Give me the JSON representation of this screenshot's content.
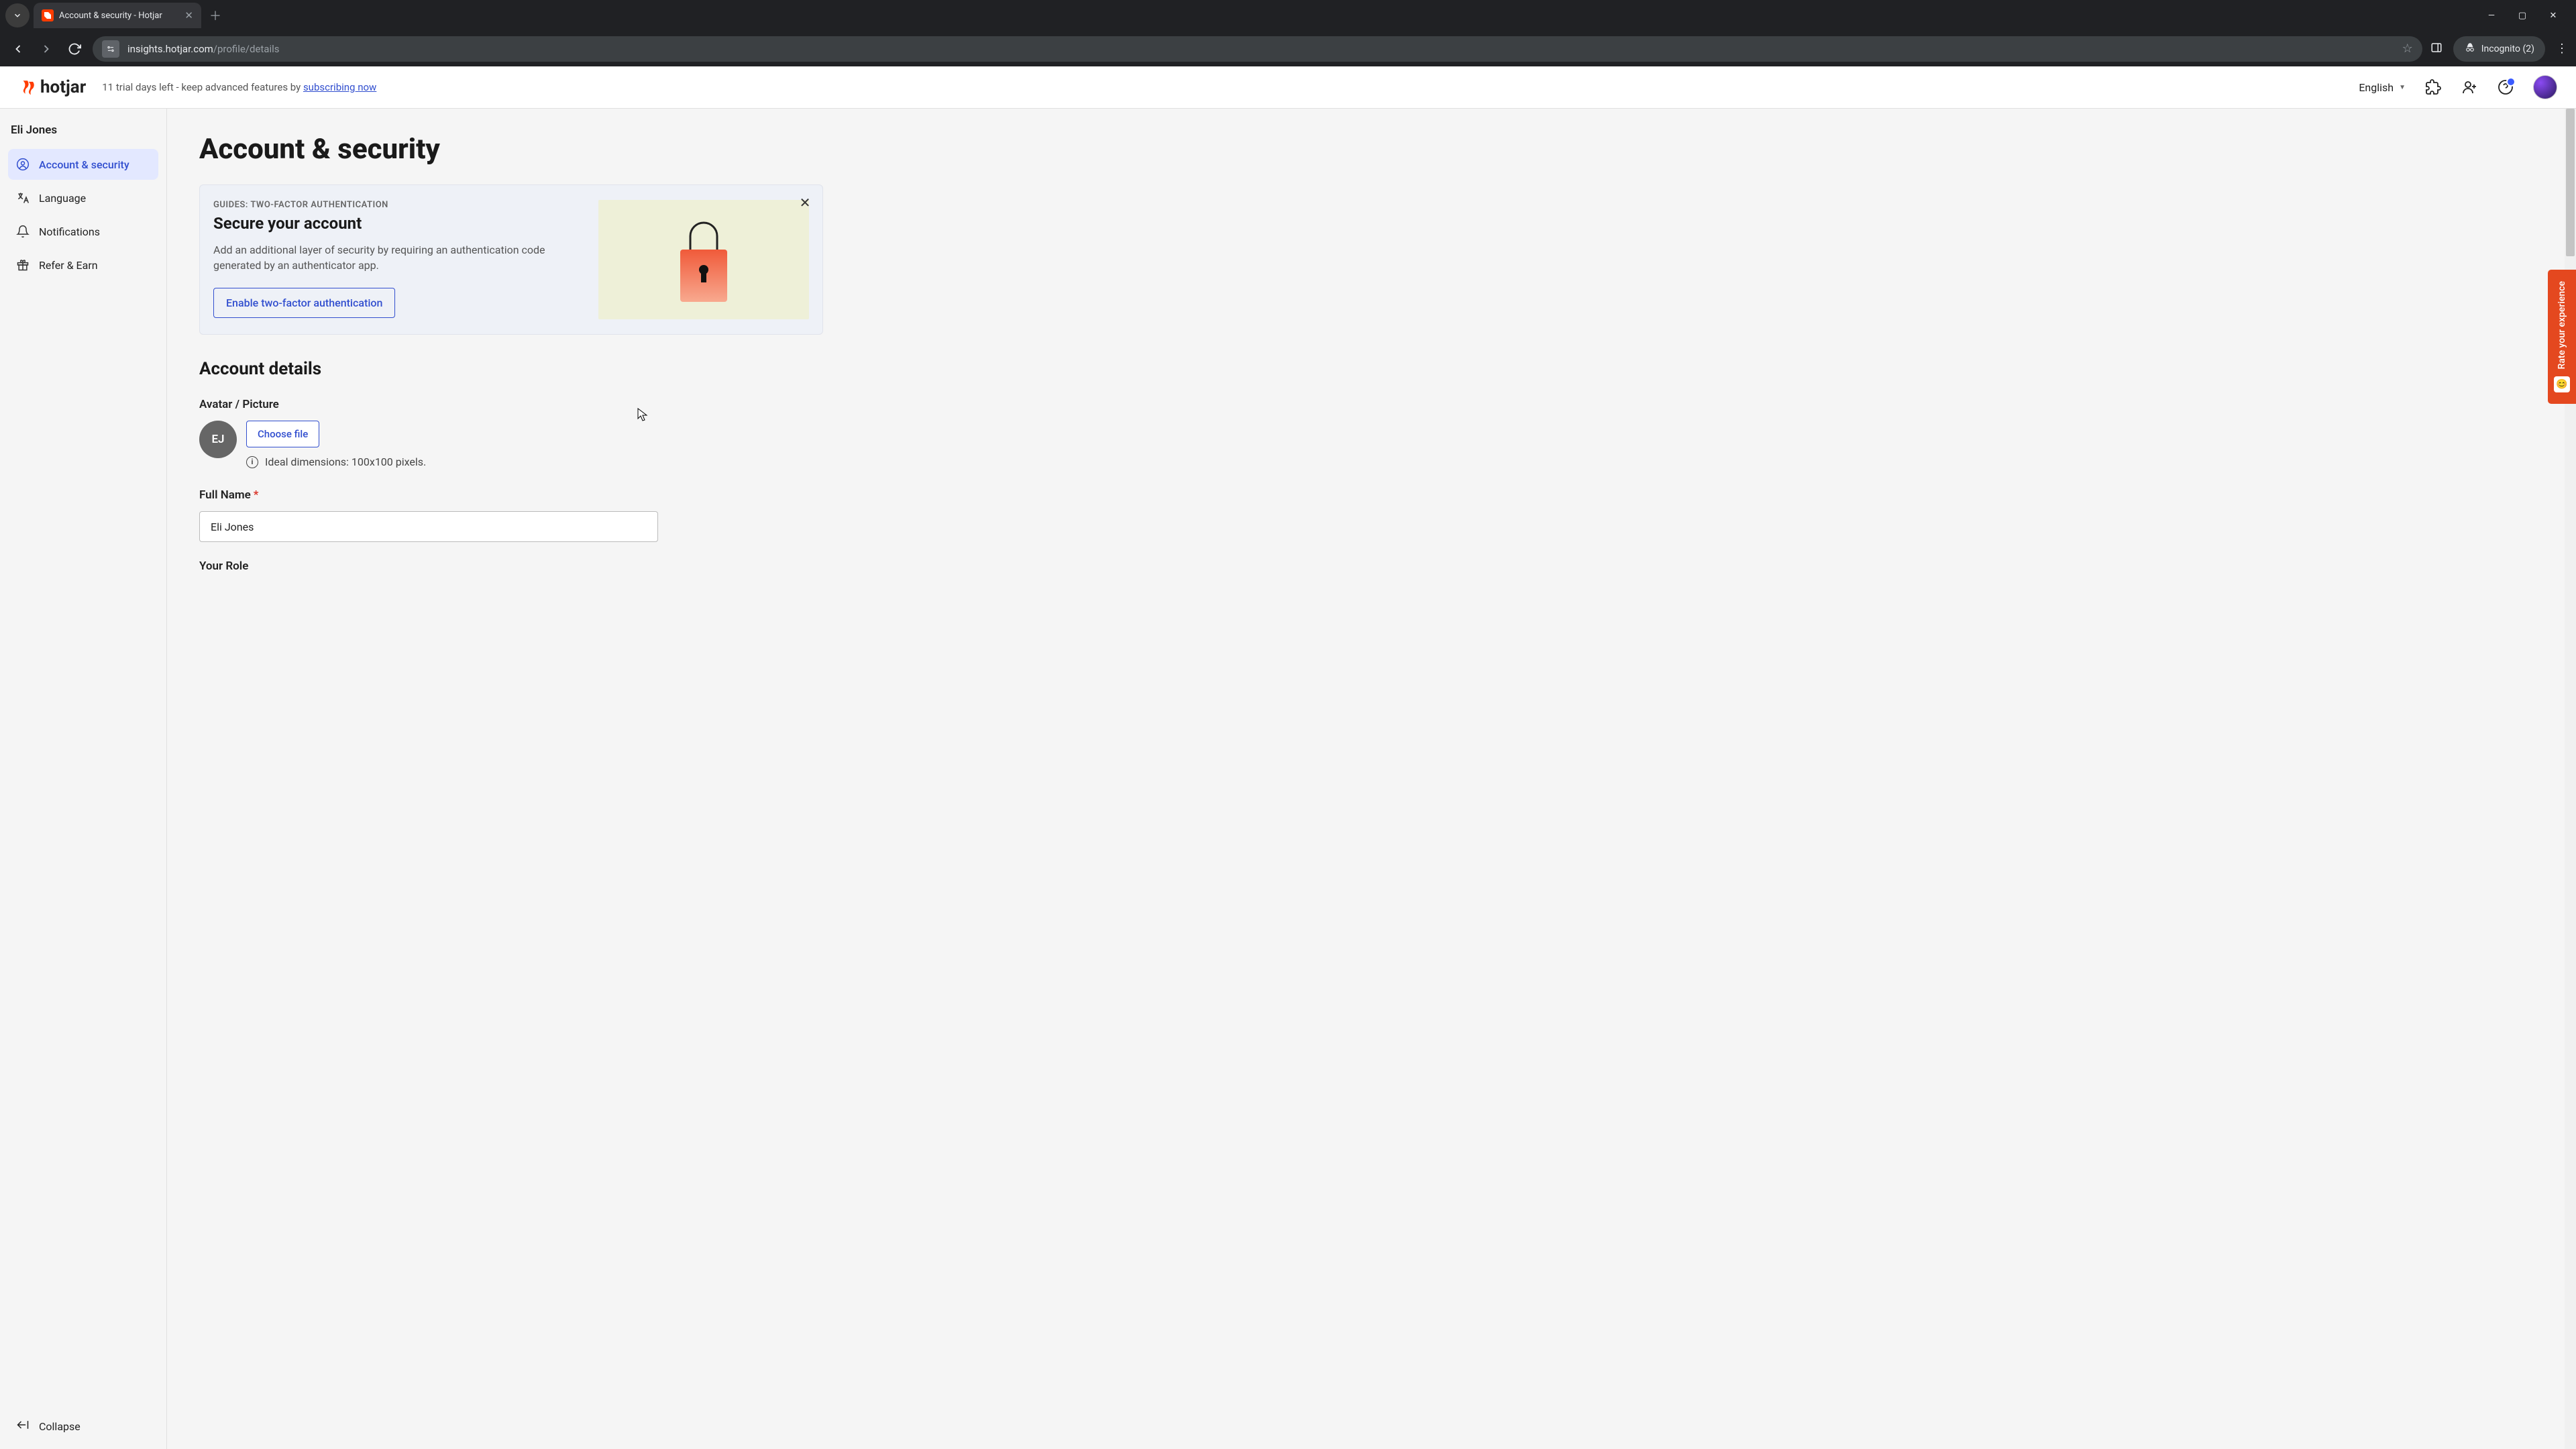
{
  "browser": {
    "tab_title": "Account & security - Hotjar",
    "url_host": "insights.hotjar.com",
    "url_path": "/profile/details",
    "incognito_label": "Incognito (2)"
  },
  "header": {
    "logo_text": "hotjar",
    "trial_text": "11 trial days left - keep advanced features by ",
    "trial_link": "subscribing now",
    "language": "English"
  },
  "sidebar": {
    "user_name": "Eli Jones",
    "items": [
      {
        "label": "Account & security"
      },
      {
        "label": "Language"
      },
      {
        "label": "Notifications"
      },
      {
        "label": "Refer & Earn"
      }
    ],
    "collapse_label": "Collapse"
  },
  "page": {
    "title": "Account & security",
    "banner": {
      "eyebrow": "GUIDES: TWO-FACTOR AUTHENTICATION",
      "title": "Secure your account",
      "description": "Add an additional layer of security by requiring an authentication code generated by an authenticator app.",
      "button": "Enable two-factor authentication"
    },
    "account_details": {
      "section_title": "Account details",
      "avatar_label": "Avatar / Picture",
      "avatar_initials": "EJ",
      "choose_file": "Choose file",
      "dimensions_hint": "Ideal dimensions: 100x100 pixels.",
      "full_name_label": "Full Name",
      "full_name_value": "Eli Jones",
      "your_role_label": "Your Role"
    }
  },
  "feedback": {
    "label": "Rate your experience"
  }
}
